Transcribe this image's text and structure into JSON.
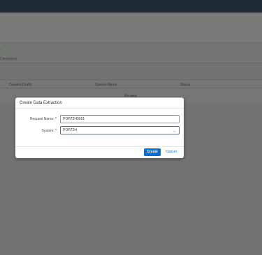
{
  "background": {
    "step_label": "Completed",
    "table": {
      "columns": [
        "Created Drafts",
        "System Name",
        "Status"
      ],
      "empty_text": "No data"
    }
  },
  "dialog": {
    "title": "Create Data Extraction",
    "fields": {
      "request_name": {
        "label": "Request Name:",
        "required_mark": "*",
        "value": "POPZ2H0001"
      },
      "system": {
        "label": "System:",
        "required_mark": "*",
        "value": "POPZ2H"
      }
    },
    "buttons": {
      "create": "Create",
      "cancel": "Cancel"
    }
  },
  "colors": {
    "accent": "#0a6ed1",
    "overlay": "#727272",
    "shellbar": "#1e2a36",
    "required": "#bb0000"
  },
  "icons": {
    "step": "check-circle-icon",
    "dropdown": "chevron-down-icon"
  }
}
